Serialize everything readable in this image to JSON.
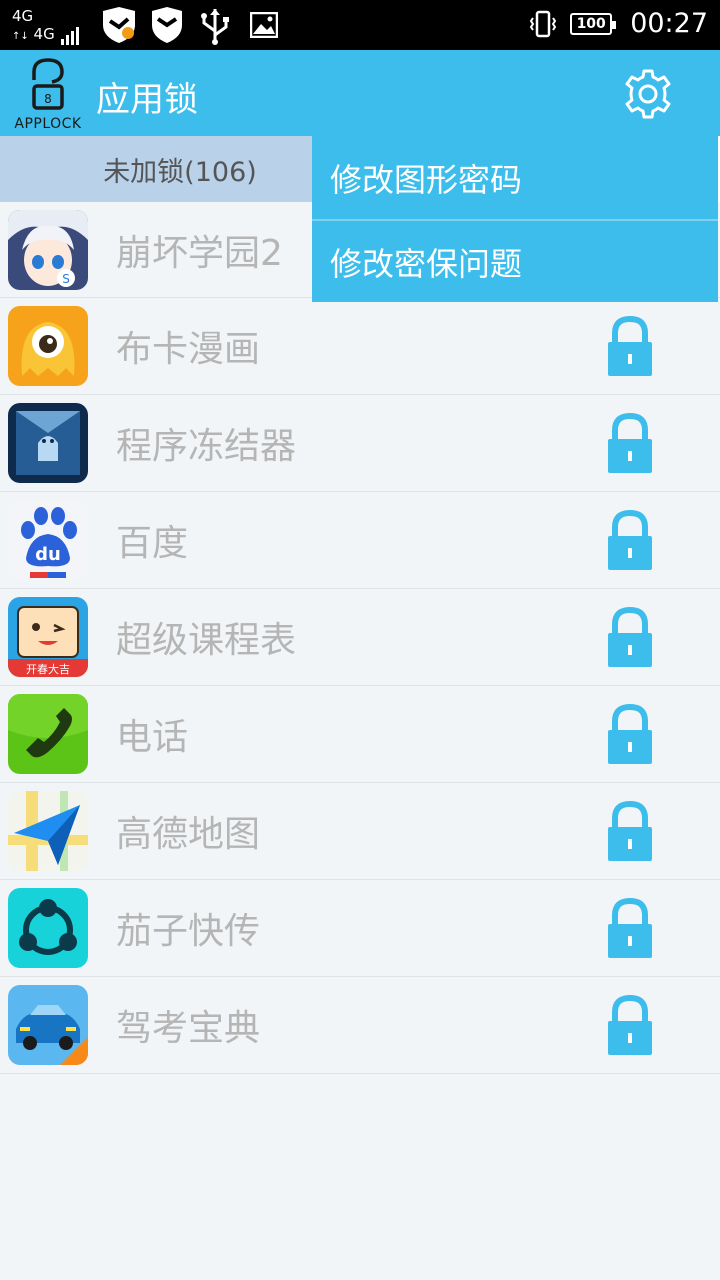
{
  "status_bar": {
    "network_1": "4G",
    "network_2": "4G",
    "battery": "100",
    "time": "00:27"
  },
  "app_bar": {
    "logo_text": "APPLOCK",
    "title": "应用锁",
    "settings_icon": "gear-icon"
  },
  "tabs": {
    "unlocked_label": "未加锁(106)"
  },
  "menu": {
    "items": [
      {
        "label": "修改图形密码"
      },
      {
        "label": "修改密保问题"
      }
    ]
  },
  "apps": [
    {
      "name": "崩坏学园2",
      "icon": "honkai-icon"
    },
    {
      "name": "布卡漫画",
      "icon": "buka-icon"
    },
    {
      "name": "程序冻结器",
      "icon": "freezer-icon"
    },
    {
      "name": "百度",
      "icon": "baidu-icon"
    },
    {
      "name": "超级课程表",
      "icon": "super-schedule-icon"
    },
    {
      "name": "电话",
      "icon": "phone-icon"
    },
    {
      "name": "高德地图",
      "icon": "amap-icon"
    },
    {
      "name": "茄子快传",
      "icon": "shareit-icon"
    },
    {
      "name": "驾考宝典",
      "icon": "driving-test-icon"
    }
  ],
  "colors": {
    "accent": "#3dbdeb",
    "tab_selected": "#b9d2e9",
    "lock": "#3dbdeb"
  }
}
